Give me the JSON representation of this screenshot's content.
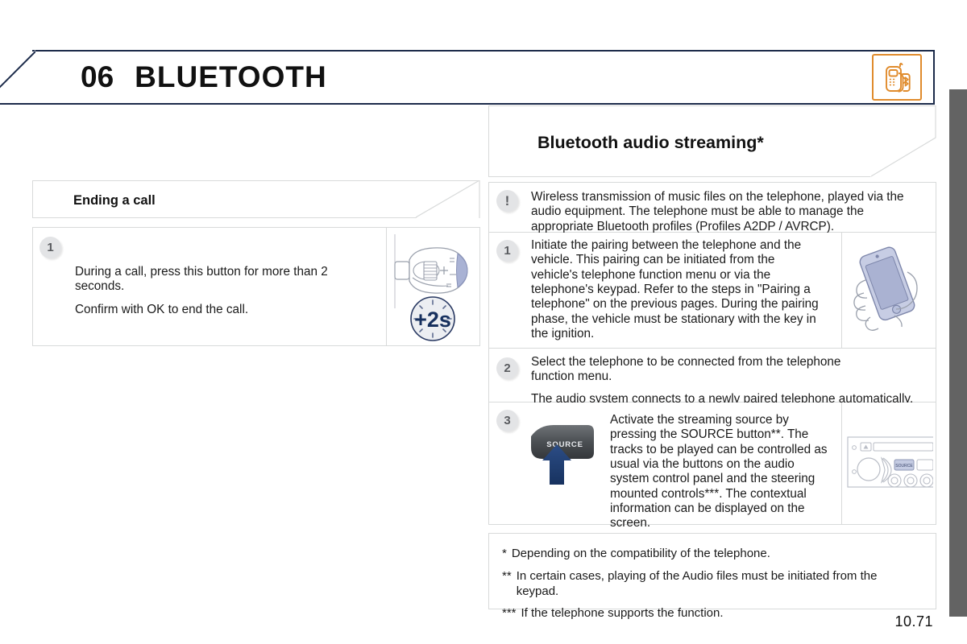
{
  "header": {
    "chapter_number": "06",
    "chapter_name": "BLUETOOTH",
    "icon_name": "bluetooth-phone-icon",
    "border_color": "#1c2b4a",
    "icon_color": "#e08b2c"
  },
  "left_column": {
    "section_title": "Ending a call",
    "step": {
      "number": "1",
      "lines": [
        "During a call, press this button for more than 2 seconds.",
        "Confirm with OK to end the call."
      ],
      "illustration": "steering-wheel-control-plus-2s",
      "illustration_label": "+2s"
    }
  },
  "right_column": {
    "section_title": "Bluetooth audio streaming*",
    "warning": {
      "icon": "exclamation-badge",
      "text": "Wireless transmission of music files on the telephone, played via the audio equipment. The telephone must be able to manage the appropriate Bluetooth profiles (Profiles A2DP / AVRCP)."
    },
    "steps": [
      {
        "number": "1",
        "text": "Initiate the pairing between the telephone and the vehicle. This pairing can be initiated from the vehicle's telephone function menu or via the telephone's keypad. Refer to the steps in \"Pairing a telephone\" on the previous pages. During the pairing phase, the vehicle must be stationary with the key in the ignition.",
        "illustration": "hand-holding-phone"
      },
      {
        "number": "2",
        "text_lines": [
          "Select the telephone to be connected from the telephone function menu.",
          "The audio system connects to a newly paired telephone automatically."
        ]
      },
      {
        "number": "3",
        "button_label": "SOURCE",
        "illustration_left": "source-button-press-arrow",
        "text": "Activate the streaming source by pressing the SOURCE button**. The tracks to be played can be controlled as usual via the buttons on the audio system control panel and the steering mounted controls***. The contextual information can be displayed on the screen.",
        "illustration_right": "car-audio-control-panel"
      }
    ],
    "footnotes": [
      {
        "marker": "*",
        "text": "Depending on the compatibility of the telephone."
      },
      {
        "marker": "**",
        "text": "In certain cases, playing of the Audio files must be initiated from the keypad."
      },
      {
        "marker": "***",
        "text": "If the telephone supports the function."
      }
    ]
  },
  "page_number": "10.71"
}
